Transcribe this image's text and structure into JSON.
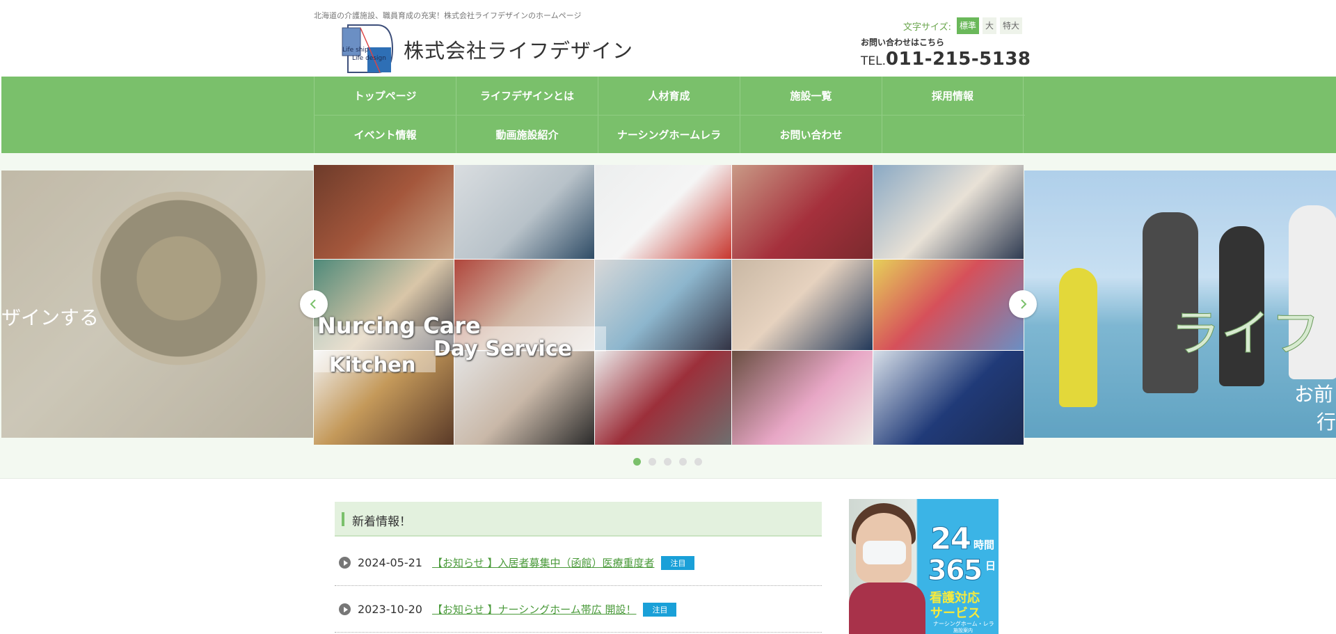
{
  "header": {
    "tagline": "北海道の介護施設、職員育成の充実！株式会社ライフデザインのホームページ",
    "logo_text_1": "Life ship",
    "logo_text_2": "Life design",
    "company_name": "株式会社ライフデザイン",
    "font_size_label": "文字サイズ:",
    "font_sizes": [
      "標準",
      "大",
      "特大"
    ],
    "contact_label": "お問い合わせはこちら",
    "tel_prefix": "TEL.",
    "tel_number": "011-215-5138"
  },
  "nav": {
    "row1": [
      "トップページ",
      "ライフデザインとは",
      "人材育成",
      "施設一覧",
      "採用情報"
    ],
    "row2": [
      "イベント情報",
      "動画施設紹介",
      "ナーシングホームレラ",
      "お問い合わせ"
    ]
  },
  "slider": {
    "left_caption": "ザインする",
    "right_caption_big": "ライフ",
    "right_caption_sub1": "お前",
    "right_caption_sub2": "行",
    "collage_text_1": "Nurcing Care",
    "collage_text_2": "Day Service",
    "collage_text_3": "Kitchen",
    "dot_count": 5,
    "active_dot": 0
  },
  "news": {
    "heading": "新着情報！",
    "items": [
      {
        "date": "2024-05-21",
        "title": "【お知らせ 】入居者募集中（函館）医療重度者",
        "badge": "注目"
      },
      {
        "date": "2023-10-20",
        "title": "【お知らせ 】ナーシングホーム帯広 開設！",
        "badge": "注目"
      }
    ]
  },
  "ad": {
    "line1": "24",
    "line1_suffix": "時間",
    "line2": "365",
    "line2_suffix": "日",
    "line3": "看護対応",
    "line4": "サービス",
    "line5": "ナーシングホーム・レラ",
    "line6": "施設案内"
  },
  "colors": {
    "nav_green": "#7ac06b",
    "accent_green": "#6ab85a",
    "badge_blue": "#1aa0d8",
    "link_green": "#4a9a3a"
  }
}
